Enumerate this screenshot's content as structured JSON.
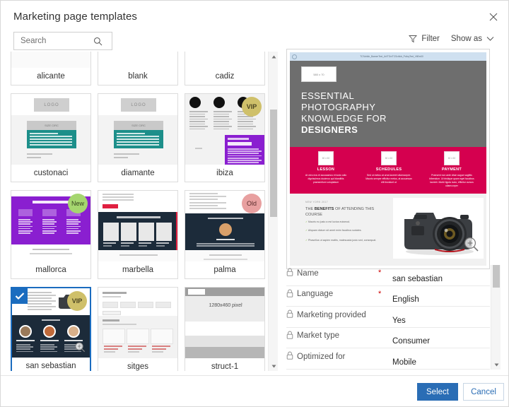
{
  "dialog": {
    "title": "Marketing page templates",
    "close_icon": "close-icon"
  },
  "toolbar": {
    "search_placeholder": "Search",
    "search_value": "",
    "search_icon": "search-icon",
    "filter_label": "Filter",
    "filter_icon": "filter-icon",
    "show_as_label": "Show as",
    "show_as_icon": "chevron-down-icon"
  },
  "templates": [
    {
      "name": "alicante",
      "badge": "",
      "selected": false,
      "style": "alicante"
    },
    {
      "name": "blank",
      "badge": "",
      "selected": false,
      "style": "blank"
    },
    {
      "name": "cadiz",
      "badge": "",
      "selected": false,
      "style": "cadiz"
    },
    {
      "name": "custonaci",
      "badge": "",
      "selected": false,
      "style": "teal"
    },
    {
      "name": "diamante",
      "badge": "",
      "selected": false,
      "style": "teal"
    },
    {
      "name": "ibiza",
      "badge": "VIP",
      "selected": false,
      "style": "ibiza"
    },
    {
      "name": "mallorca",
      "badge": "New",
      "selected": false,
      "style": "mallorca"
    },
    {
      "name": "marbella",
      "badge": "",
      "selected": false,
      "style": "marbella"
    },
    {
      "name": "palma",
      "badge": "Old",
      "selected": false,
      "style": "palma"
    },
    {
      "name": "san sebastian",
      "badge": "VIP",
      "selected": true,
      "style": "sansebastian"
    },
    {
      "name": "sitges",
      "badge": "",
      "selected": false,
      "style": "sitges"
    },
    {
      "name": "struct-1",
      "badge": "",
      "selected": false,
      "style": "struct1"
    }
  ],
  "thumb_text": {
    "logo": "LOGO",
    "size_label": "SIZE CIRC",
    "struct_size": "1280x460 pixel",
    "struct_size2": "1280x460 pixel"
  },
  "preview": {
    "browser_url": "TCSchildr_BannerText_Url/TGn/TCSchildr_PolicyText_VitEm00",
    "hero_image_label": "580 x 70",
    "hero_lines": [
      "ESSENTIAL",
      "PHOTOGRAPHY",
      "KNOWLEDGE FOR"
    ],
    "hero_bold_line": "DESIGNERS",
    "columns": [
      {
        "image_label": "60 x 60",
        "title": "LESSON",
        "body": "At vero eos et accusamus et iusto odio dignissimos ducimus qui blanditiis praesentium voluptatum"
      },
      {
        "image_label": "60 x 60",
        "title": "SCHEDULES",
        "body": "Sed ut metus at urna laoreet ullamcorper. Mauris semper efficitur metus, at accumsan elit tincidunt ut"
      },
      {
        "image_label": "60 x 60",
        "title": "PAYMENT",
        "body": "Praesent non ante vitae augue sagittis bibendum. Ut tristique quam eget faucibus laoreet. Morbi ligula nunc, efficitur cursus ullamcorper"
      }
    ],
    "lower": {
      "eyebrow": "NEW YORK 2017",
      "title_prefix": "THE ",
      "title_bold": "BENEFITS",
      "title_suffix": " OF ATTENDING THIS COURSE",
      "bullets": [
        "Mauris eu justo a est luctus euismod.",
        "Aliquam dictum sit amet enim faucibus sodales.",
        "Phasellus ut sapien mattis, malesuada justo sed, consequat."
      ]
    },
    "zoom_icon": "magnifier-plus-icon"
  },
  "properties": [
    {
      "icon": "lock-icon",
      "label": "Name",
      "required": true,
      "value": "san sebastian"
    },
    {
      "icon": "lock-icon",
      "label": "Language",
      "required": true,
      "value": "English"
    },
    {
      "icon": "lock-icon",
      "label": "Marketing provided",
      "required": false,
      "value": "Yes"
    },
    {
      "icon": "lock-icon",
      "label": "Market type",
      "required": false,
      "value": "Consumer"
    },
    {
      "icon": "lock-icon",
      "label": "Optimized for",
      "required": false,
      "value": "Mobile"
    }
  ],
  "footer": {
    "select_label": "Select",
    "cancel_label": "Cancel"
  },
  "colors": {
    "accent": "#2a6db5",
    "selection_border": "#1a6cbf",
    "hero_bg": "#6e6e6e",
    "band_bg": "#d5004f",
    "teal": "#1d8f8a",
    "purple": "#8a1fd0",
    "navy": "#1c2b3a",
    "vip_badge": "#cfc06a",
    "new_badge": "#a5d66f",
    "old_badge": "#e8a0a0",
    "required_star": "#cc0000"
  }
}
